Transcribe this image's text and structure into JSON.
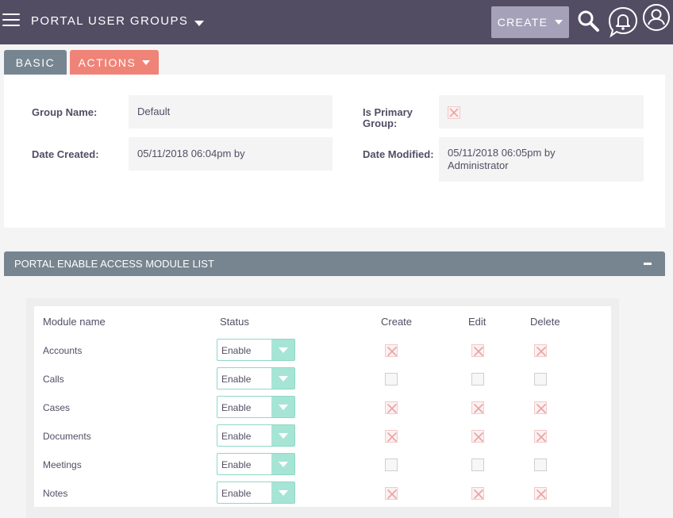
{
  "header": {
    "module_title": "PORTAL USER GROUPS",
    "create_label": "CREATE"
  },
  "tabs": {
    "basic": "BASIC",
    "actions": "ACTIONS"
  },
  "detail": {
    "group_name_label": "Group Name:",
    "group_name_value": "Default",
    "is_primary_label_1": "Is Primary",
    "is_primary_label_2": "Group:",
    "is_primary_checked": true,
    "date_created_label": "Date Created:",
    "date_created_value": "05/11/2018 06:04pm by",
    "date_modified_label": "Date Modified:",
    "date_modified_value_1": "05/11/2018 06:05pm by",
    "date_modified_value_2": "Administrator"
  },
  "module_list": {
    "title": "PORTAL ENABLE ACCESS MODULE LIST",
    "columns": [
      "Module name",
      "Status",
      "Create",
      "Edit",
      "Delete"
    ],
    "rows": [
      {
        "name": "Accounts",
        "status": "Enable",
        "create": true,
        "edit": true,
        "delete": true
      },
      {
        "name": "Calls",
        "status": "Enable",
        "create": false,
        "edit": false,
        "delete": false
      },
      {
        "name": "Cases",
        "status": "Enable",
        "create": true,
        "edit": true,
        "delete": true
      },
      {
        "name": "Documents",
        "status": "Enable",
        "create": true,
        "edit": true,
        "delete": true
      },
      {
        "name": "Meetings",
        "status": "Enable",
        "create": false,
        "edit": false,
        "delete": false
      },
      {
        "name": "Notes",
        "status": "Enable",
        "create": true,
        "edit": true,
        "delete": true
      }
    ]
  },
  "colors": {
    "nav_bg": "#534d64",
    "create_btn": "#a5a1b8",
    "tab_basic": "#778591",
    "tab_actions": "#f08377",
    "select_border": "#8fd8c6",
    "select_arrow_bg": "#a6e5d5",
    "checked_x": "#eaa3a3"
  }
}
